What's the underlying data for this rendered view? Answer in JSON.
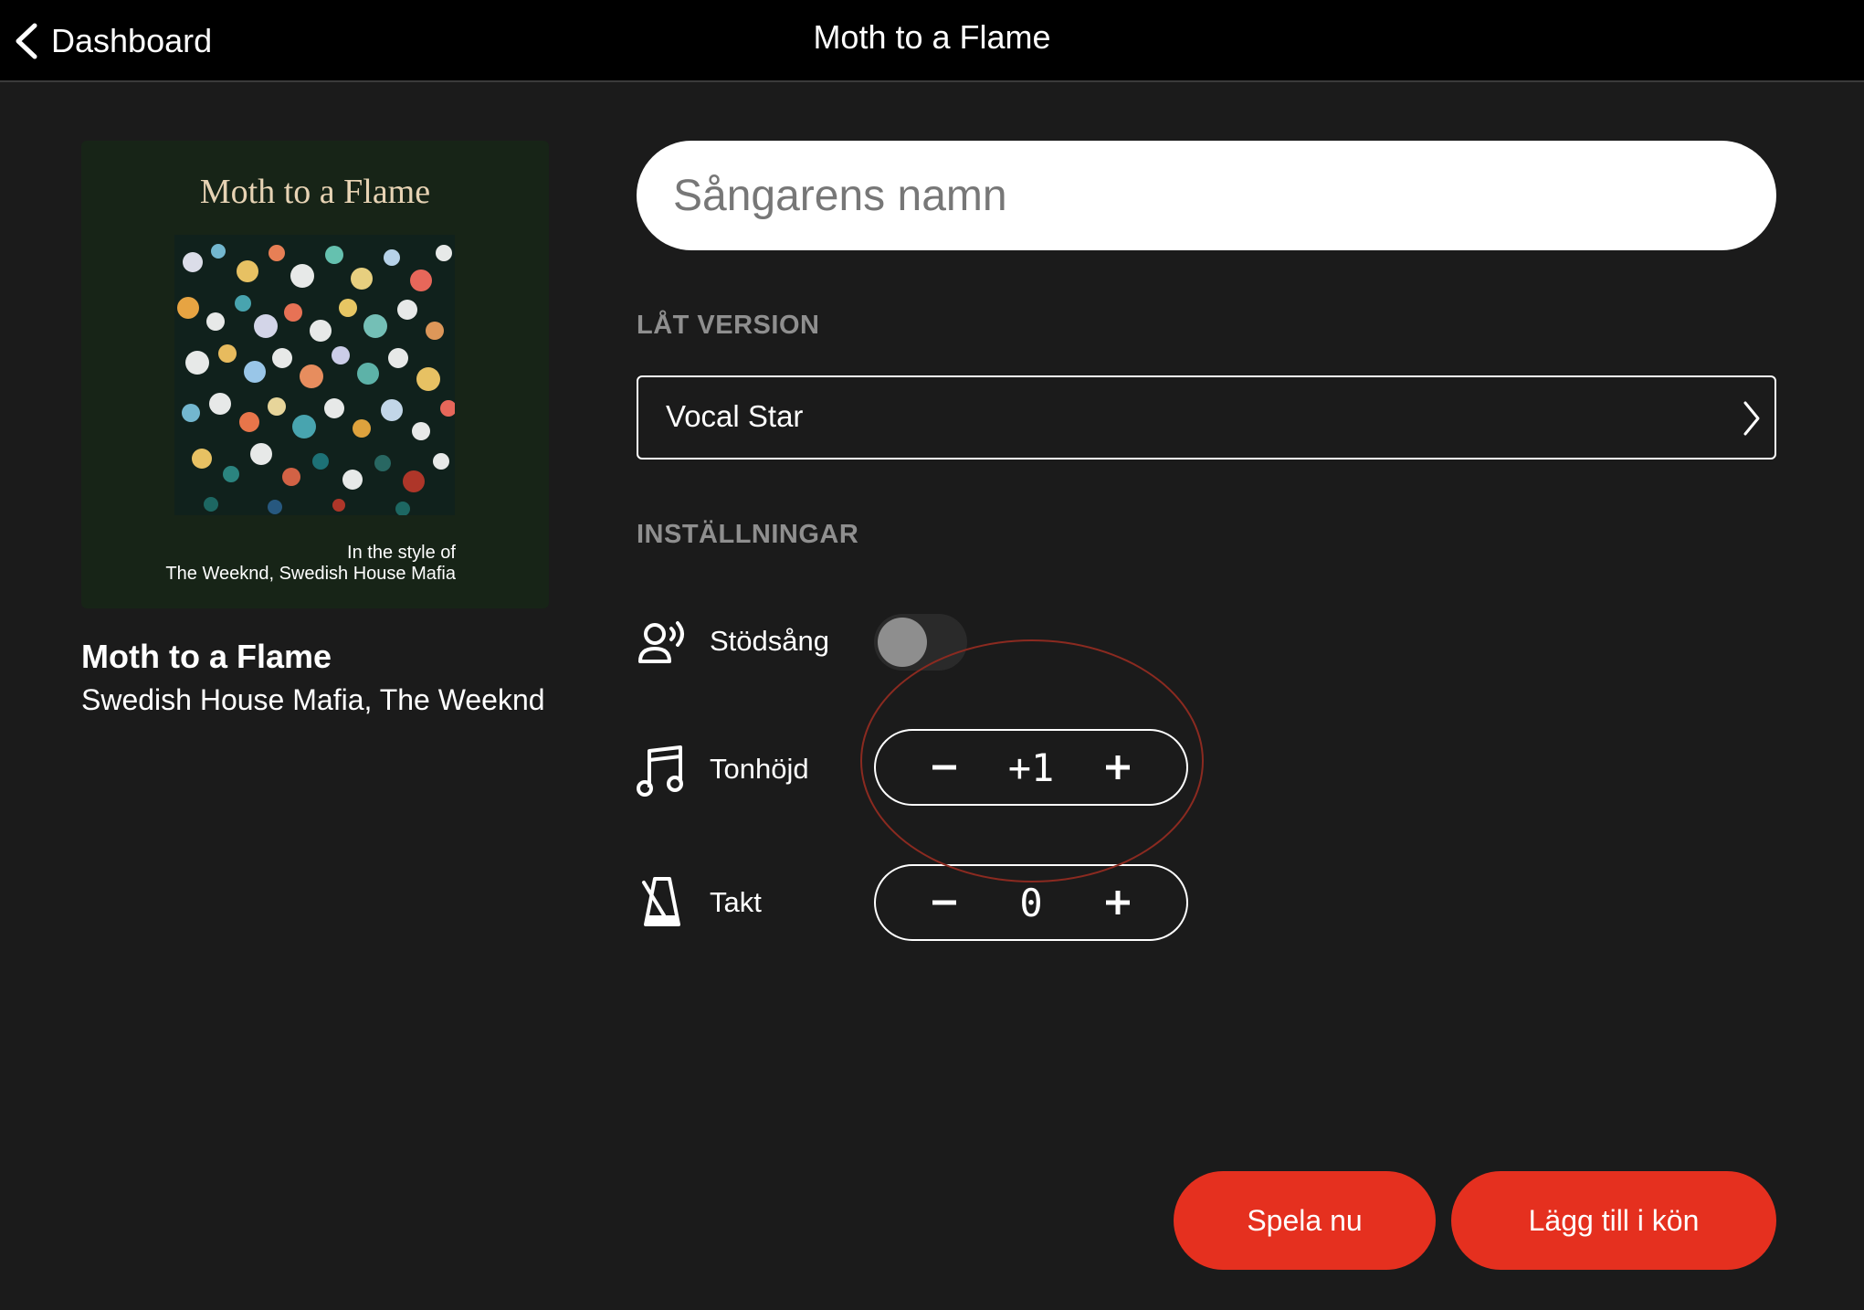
{
  "header": {
    "back_label": "Dashboard",
    "title": "Moth to a Flame"
  },
  "cover": {
    "title": "Moth to a Flame",
    "style_line1": "In the style of",
    "style_line2": "The Weeknd, Swedish House Mafia"
  },
  "song": {
    "name": "Moth to a Flame",
    "artist": "Swedish House Mafia, The Weeknd"
  },
  "singer_input": {
    "placeholder": "Sångarens namn",
    "value": ""
  },
  "version": {
    "section_label": "LÅT VERSION",
    "selected": "Vocal Star"
  },
  "settings": {
    "section_label": "INSTÄLLNINGAR",
    "backing_vocals": {
      "label": "Stödsång",
      "enabled": false
    },
    "pitch": {
      "label": "Tonhöjd",
      "value": "+1"
    },
    "tempo": {
      "label": "Takt",
      "value": "0"
    }
  },
  "actions": {
    "play_now": "Spela nu",
    "add_to_queue": "Lägg till i kön"
  },
  "colors": {
    "accent": "#e5301f",
    "background": "#1b1b1b",
    "section_label": "#8f8f8f",
    "annotation": "#8b2a20"
  }
}
